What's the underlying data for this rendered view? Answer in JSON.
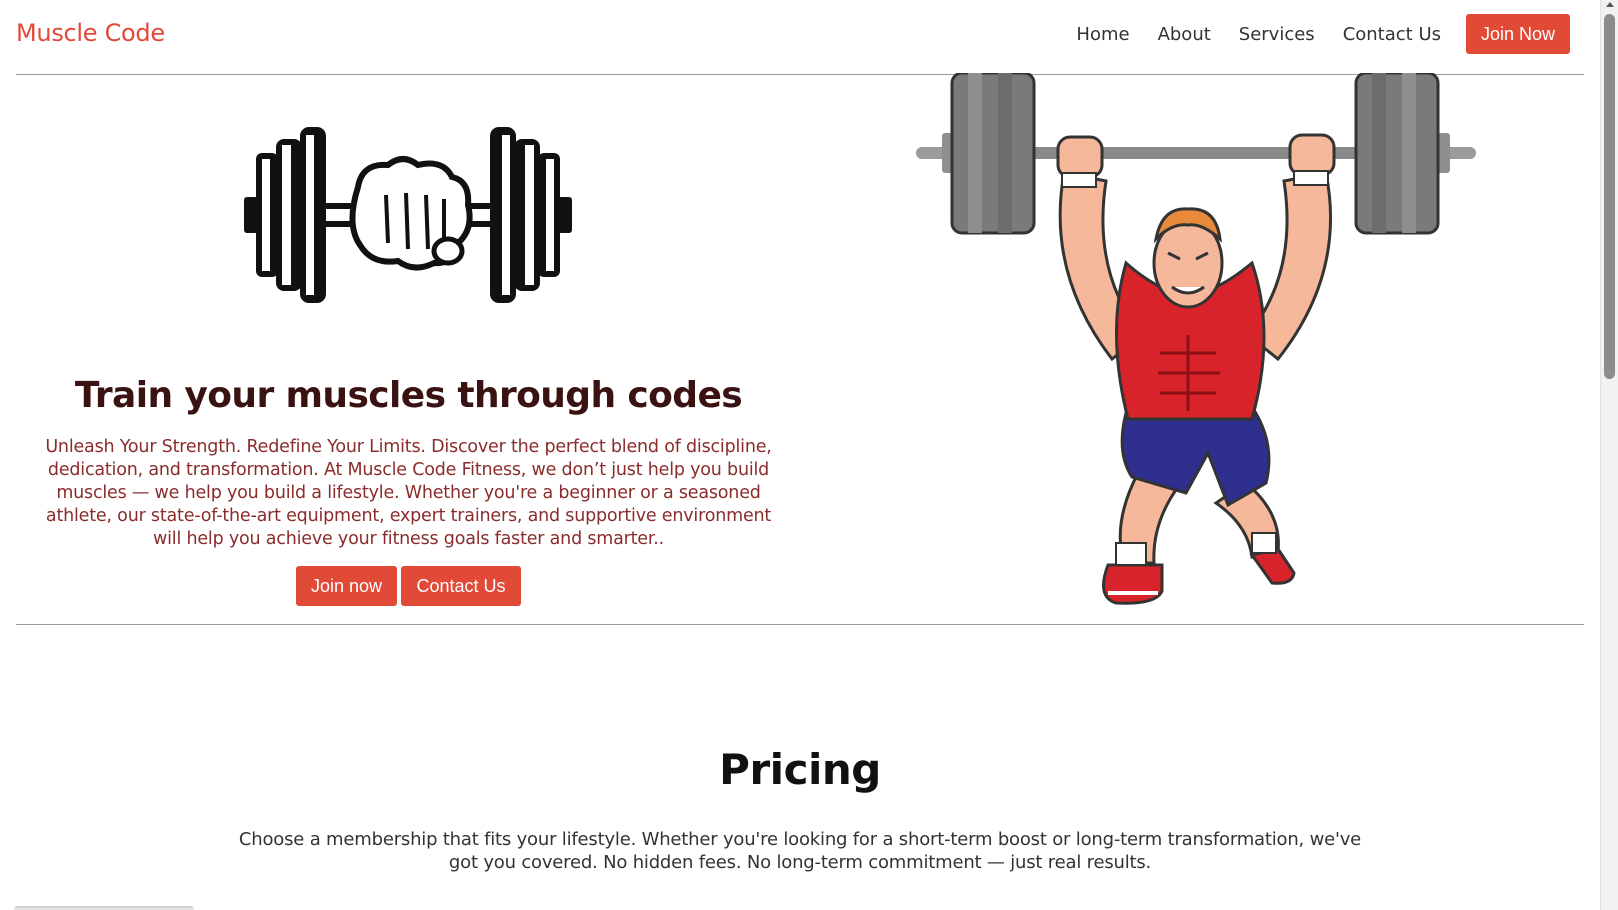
{
  "header": {
    "brand": "Muscle Code",
    "nav": [
      {
        "label": "Home"
      },
      {
        "label": "About"
      },
      {
        "label": "Services"
      },
      {
        "label": "Contact Us"
      }
    ],
    "cta_label": "Join Now"
  },
  "hero": {
    "title": "Train your muscles through codes",
    "text": "Unleash Your Strength. Redefine Your Limits. Discover the perfect blend of discipline, dedication, and transformation. At Muscle Code Fitness, we don’t just help you build muscles — we help you build a lifestyle. Whether you're a beginner or a seasoned athlete, our state-of-the-art equipment, expert trainers, and supportive environment will help you achieve your fitness goals faster and smarter..",
    "join_label": "Join now",
    "contact_label": "Contact Us",
    "left_image_icon": "dumbbell-fist-icon",
    "right_image_icon": "weightlifter-illustration"
  },
  "pricing": {
    "title": "Pricing",
    "text": "Choose a membership that fits your lifestyle. Whether you're looking for a short-term boost or long-term transformation, we've got you covered. No hidden fees. No long-term commitment — just real results."
  },
  "colors": {
    "accent": "#e04a37",
    "hero_title": "#3a1212",
    "hero_text": "#8b2c2c"
  }
}
